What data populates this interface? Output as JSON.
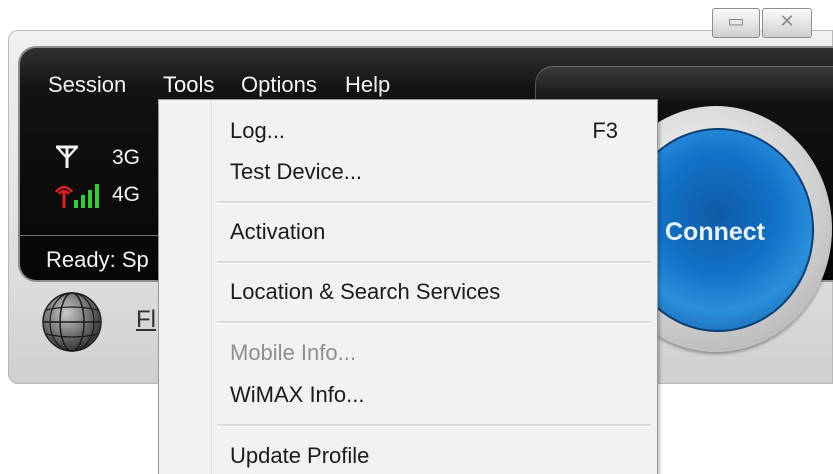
{
  "window": {
    "buttons": {
      "minimize_icon": "minimize-icon",
      "close_icon": "close-icon"
    }
  },
  "menubar": {
    "items": [
      {
        "label": "Session"
      },
      {
        "label": "Tools"
      },
      {
        "label": "Options"
      },
      {
        "label": "Help"
      }
    ],
    "active": "Tools"
  },
  "network": {
    "rows": [
      {
        "label": "3G",
        "icon": "antenna-icon"
      },
      {
        "label": "4G",
        "icon": "signal-bars-icon"
      }
    ]
  },
  "status": {
    "text": "Ready: Sp"
  },
  "brand": {
    "text": "Fl"
  },
  "connect": {
    "label": "Connect"
  },
  "tools_menu": {
    "items": [
      {
        "label": "Log...",
        "shortcut": "F3",
        "enabled": true
      },
      {
        "label": "Test Device...",
        "enabled": true
      },
      {
        "label": "Activation",
        "enabled": true
      },
      {
        "label": "Location & Search Services",
        "enabled": true
      },
      {
        "label": "Mobile Info...",
        "enabled": false
      },
      {
        "label": "WiMAX Info...",
        "enabled": true
      },
      {
        "label": "Update Profile",
        "enabled": true
      }
    ]
  },
  "colors": {
    "panel": "#0a0a0a",
    "connect_blue": "#1272c7",
    "signal_red": "#e02020",
    "signal_green": "#2fd12f",
    "menu_bg": "#f2f2f2",
    "disabled_text": "#8e8e8e"
  }
}
